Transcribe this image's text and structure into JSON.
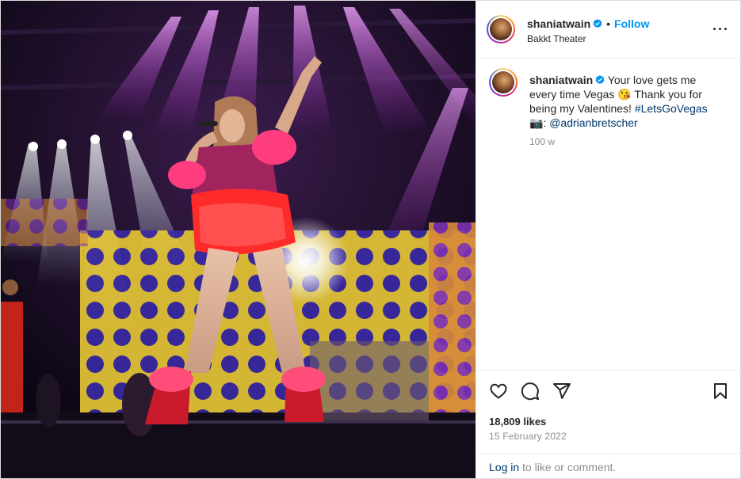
{
  "post": {
    "username": "shaniatwain",
    "follow_label": "Follow",
    "dot": "•",
    "location": "Bakkt Theater"
  },
  "caption": {
    "username": "shaniatwain",
    "text_1": "Your love gets me every time Vegas ",
    "emoji_1": "😘",
    "text_2": " Thank you for being my Valentines! ",
    "hashtag": "#LetsGoVegas",
    "emoji_2": "📷",
    "text_3": ": ",
    "mention": "@adrianbretscher",
    "time_ago": "100 w"
  },
  "stats": {
    "likes": "18,809 likes",
    "date": "15 February 2022"
  },
  "footer": {
    "login_link": "Log in",
    "login_rest": " to like or comment."
  },
  "icons": {
    "verified": "verified-badge-icon",
    "more": "more-options-icon",
    "like": "heart-icon",
    "comment": "comment-icon",
    "share": "share-icon",
    "save": "bookmark-icon"
  },
  "colors": {
    "accent": "#0095f6",
    "link": "#00376b",
    "muted": "#8e8e8e",
    "text": "#262626"
  }
}
